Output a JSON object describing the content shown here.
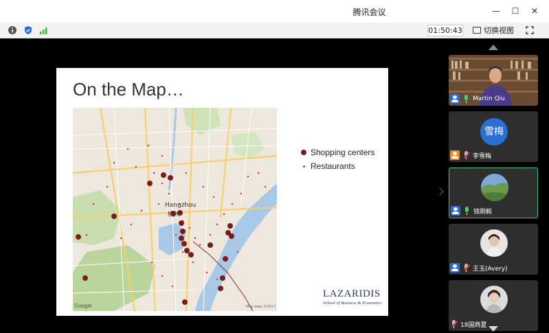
{
  "window": {
    "title": "腾讯会议"
  },
  "toolbar": {
    "timer": "01:50:43",
    "switch_view_label": "切换视图"
  },
  "slide": {
    "title": "On the Map…",
    "legend": [
      "Shopping centers",
      "Restaurants"
    ],
    "map_labels": {
      "hangzhou_en": "Hangzhou",
      "hangzhou_cn": "杭州",
      "google": "Google",
      "map_data": "Map data ©2017"
    },
    "logo": {
      "name": "LAZARIDIS",
      "subtitle": "School of Business & Economics"
    }
  },
  "participants": [
    {
      "name": "Martin Qiu",
      "mic": "active",
      "avatar": "video"
    },
    {
      "name": "李雪梅",
      "avatar_text": "雪梅",
      "mic": "muted",
      "avatar": "text"
    },
    {
      "name": "钱刚毅",
      "mic": "speaking",
      "avatar": "photo"
    },
    {
      "name": "王玉(Avery)",
      "mic": "muted",
      "avatar": "photo"
    },
    {
      "name": "18国商夏",
      "mic": "muted",
      "avatar": "photo"
    }
  ],
  "colors": {
    "accent_blue": "#2b6fd6",
    "active_green": "#48c27e",
    "shopping_dot": "#6e1e1e",
    "restaurant_dot": "#d0303a"
  }
}
